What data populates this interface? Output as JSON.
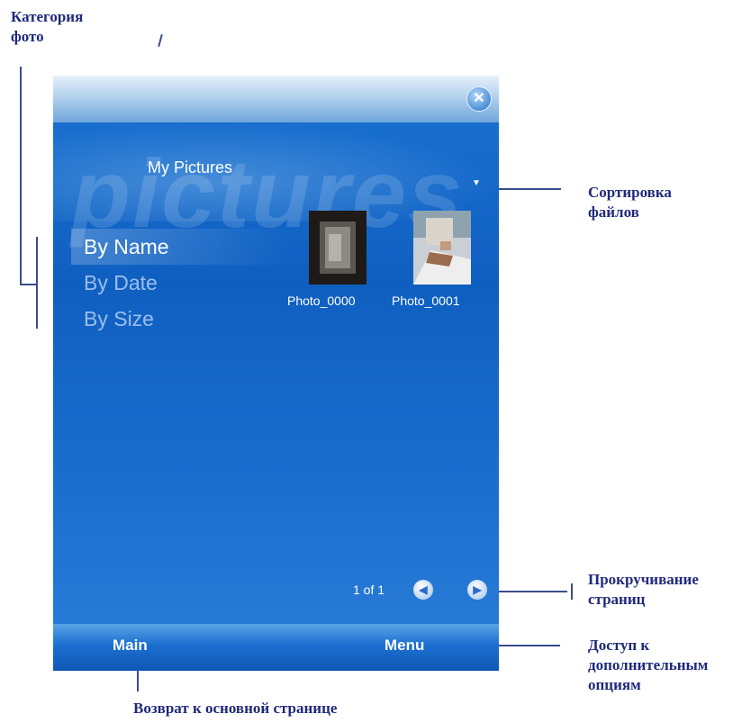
{
  "callouts": {
    "photo_category": [
      "Категория",
      "фото"
    ],
    "file_sort": [
      "Сортировка",
      "файлов"
    ],
    "page_scroll": [
      "Прокручивание",
      "страниц"
    ],
    "more_options": [
      "Доступ к",
      "дополнительным",
      "опциям"
    ],
    "back_main": "Возврат к основной странице"
  },
  "app": {
    "watermark": "pictures",
    "album_title": "My Pictures",
    "sort_menu_icon": "triangle-down-icon",
    "close_icon": "close-icon"
  },
  "sort_options": [
    {
      "label": "By Name",
      "selected": true
    },
    {
      "label": "By Date",
      "selected": false
    },
    {
      "label": "By Size",
      "selected": false
    }
  ],
  "photos": [
    {
      "name": "Photo_0000"
    },
    {
      "name": "Photo_0001"
    }
  ],
  "pager": {
    "text": "1 of 1",
    "prev_icon": "previous-page-icon",
    "next_icon": "next-page-icon"
  },
  "softkeys": {
    "left": "Main",
    "right": "Menu"
  },
  "colors": {
    "accent": "#1b73d2",
    "callout_text": "#1f2a7a"
  }
}
